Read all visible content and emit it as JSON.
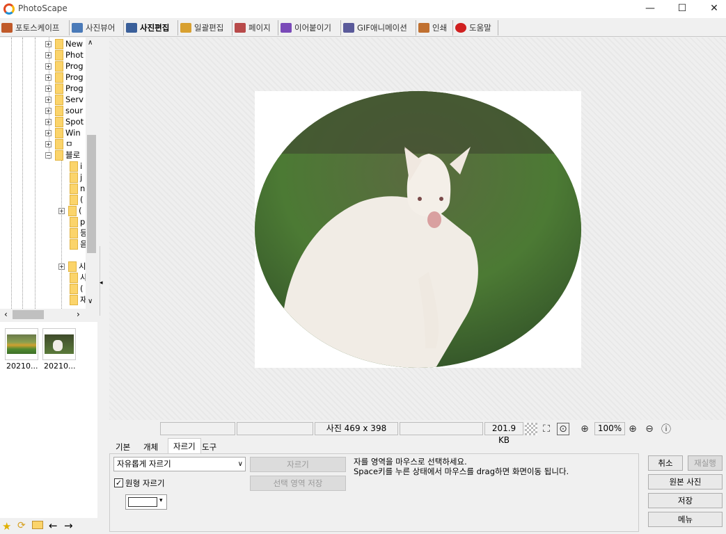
{
  "window": {
    "title": "PhotoScape",
    "minimize": "—",
    "maximize": "☐",
    "close": "✕"
  },
  "tabs": [
    {
      "label": "포토스케이프",
      "color": "#c05a2a"
    },
    {
      "label": "사진뷰어",
      "color": "#4a7ab8"
    },
    {
      "label": "사진편집",
      "color": "#3a5f9a"
    },
    {
      "label": "일괄편집",
      "color": "#d8a030"
    },
    {
      "label": "페이지",
      "color": "#b84a4a"
    },
    {
      "label": "이어붙이기",
      "color": "#7a4ab8"
    },
    {
      "label": "GIF애니메이션",
      "color": "#5a5a9a"
    },
    {
      "label": "인쇄",
      "color": "#c07030"
    },
    {
      "label": "도움말",
      "color": "#d02020"
    }
  ],
  "tree": {
    "top_nodes": [
      "New",
      "Phot",
      "Prog",
      "Prog",
      "Prog",
      "Serv",
      "sour",
      "Spot",
      "Win",
      "ㅁ",
      "블로"
    ],
    "child_nodes": [
      "i",
      "j",
      "n",
      "(",
      "(",
      "p",
      "등",
      "음",
      "시",
      "사",
      "(",
      "재"
    ]
  },
  "thumbnails": [
    {
      "caption": "20210..."
    },
    {
      "caption": "20210..."
    }
  ],
  "status": {
    "field1": "",
    "field2": "",
    "dimensions": "사진 469 x 398",
    "field4": "",
    "filesize": "201.9 KB",
    "zoom": "100%"
  },
  "bottom_tabs": [
    "기본",
    "개체",
    "자르기",
    "도구"
  ],
  "crop": {
    "mode": "자유롭게 자르기",
    "crop_button": "자르기",
    "save_selection_button": "선택 영역 저장",
    "circle_crop_label": "원형 자르기",
    "circle_crop_checked": "✓",
    "hint_line1": "자를 영역을 마우스로 선택하세요.",
    "hint_line2": "Space키를 누른 상태에서 마우스를 drag하면 화면이동 됩니다."
  },
  "side_buttons": {
    "cancel": "취소",
    "redo": "재실행",
    "original": "원본 사진",
    "save": "저장",
    "menu": "메뉴"
  }
}
